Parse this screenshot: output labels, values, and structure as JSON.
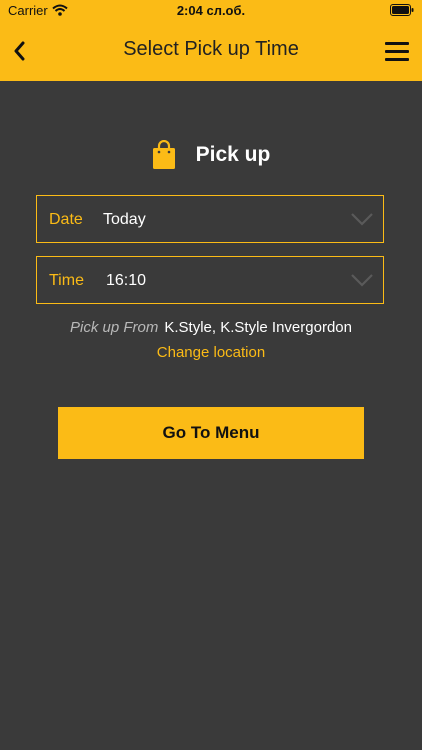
{
  "status_bar": {
    "carrier": "Carrier",
    "time": "2:04 сл.об."
  },
  "header": {
    "title": "Select Pick up Time"
  },
  "pickup": {
    "heading": "Pick up"
  },
  "fields": {
    "date": {
      "label": "Date",
      "value": "Today"
    },
    "time": {
      "label": "Time",
      "value": "16:10"
    }
  },
  "location": {
    "from_label": "Pick up From",
    "value": "K.Style, K.Style Invergordon",
    "change_link": "Change location"
  },
  "cta": {
    "label": "Go To Menu"
  },
  "colors": {
    "accent": "#fbbb16",
    "background": "#3a3a3a"
  },
  "icons": [
    "wifi-icon",
    "battery-icon",
    "back-icon",
    "hamburger-menu-icon",
    "shopping-bag-icon",
    "chevron-down-icon"
  ]
}
